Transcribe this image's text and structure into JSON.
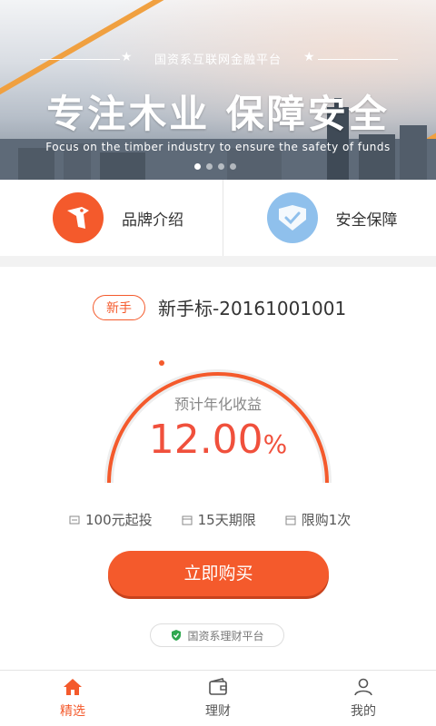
{
  "banner": {
    "platform_line": "国资系互联网金融平台",
    "headline": "专注木业  保障安全",
    "english": "Focus on the timber industry to ensure the safety of funds",
    "slides": 4,
    "active_slide": 1
  },
  "features": [
    {
      "label": "品牌介绍",
      "icon": "woodpecker-icon",
      "color": "#f45a2c"
    },
    {
      "label": "安全保障",
      "icon": "shield-icon",
      "color": "#8fc0ec"
    }
  ],
  "product": {
    "tag": "新手",
    "name": "新手标-20161001001",
    "rate_label": "预计年化收益",
    "rate_value": "12.00",
    "rate_unit": "%",
    "min_invest": "100元起投",
    "term": "15天期限",
    "limit": "限购1次",
    "buy_label": "立即购买",
    "platform_badge": "国资系理财平台",
    "progress": 0.0
  },
  "tabs": [
    {
      "label": "精选",
      "icon": "home-icon",
      "active": true
    },
    {
      "label": "理财",
      "icon": "wallet-icon",
      "active": false
    },
    {
      "label": "我的",
      "icon": "user-icon",
      "active": false
    }
  ],
  "colors": {
    "accent": "#f45a2c",
    "rate": "#f0503c"
  }
}
